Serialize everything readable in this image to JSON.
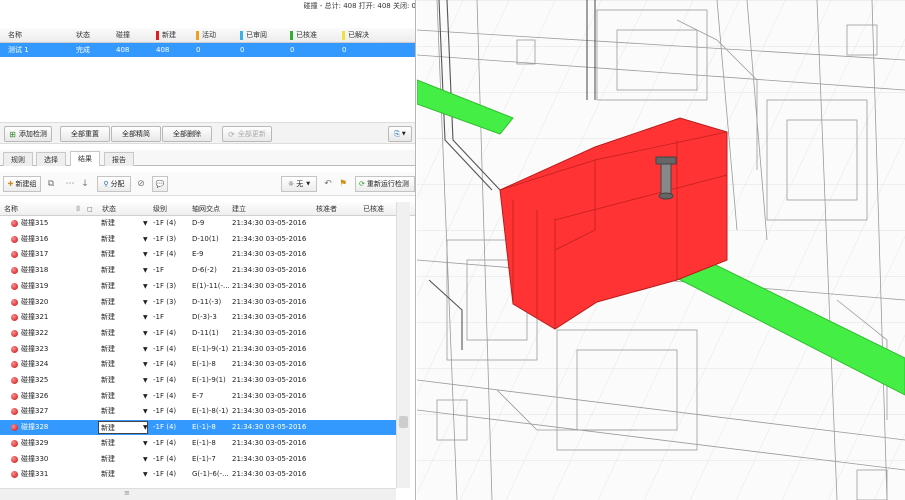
{
  "status_line": "碰撞 - 总计: 408 打开: 408 关闭: 0",
  "test_table": {
    "headers": {
      "name": "名称",
      "status": "状态",
      "clashes": "碰撞",
      "new": "新建",
      "active": "活动",
      "reviewed": "已审阅",
      "approved": "已核准",
      "resolved": "已解决"
    },
    "row": {
      "name": "测试 1",
      "status": "完成",
      "clashes": "408",
      "new": "408",
      "active": "0",
      "reviewed": "0",
      "approved": "0",
      "resolved": "0"
    }
  },
  "colors": {
    "new": "#e01e1e",
    "active": "#f0a020",
    "reviewed": "#3ab0e8",
    "approved": "#30b030",
    "resolved": "#f0e040",
    "selection": "#3399ff",
    "clash_box": "#ff3333",
    "pipe": "#44ee44"
  },
  "toolbar1": {
    "add_test": "添加检测",
    "reset_all": "全部重置",
    "compact_all": "全部精简",
    "delete_all": "全部删除",
    "update_all": "全部更新"
  },
  "tabs": [
    "规则",
    "选择",
    "结果",
    "报告"
  ],
  "toolbar2": {
    "new_group": "新建组",
    "assign": "分配",
    "none": "无",
    "rerun": "重新运行检测"
  },
  "results_headers": {
    "name": "名称",
    "status": "状态",
    "level": "级别",
    "grid": "轴网交点",
    "created": "建立",
    "approved_by": "核准者",
    "approved": "已核准"
  },
  "results": [
    {
      "name": "碰撞315",
      "status": "新建",
      "level": "-1F (4)",
      "grid": "D-9",
      "created": "21:34:30 03-05-2016"
    },
    {
      "name": "碰撞316",
      "status": "新建",
      "level": "-1F (3)",
      "grid": "D-10(1)",
      "created": "21:34:30 03-05-2016"
    },
    {
      "name": "碰撞317",
      "status": "新建",
      "level": "-1F (4)",
      "grid": "E-9",
      "created": "21:34:30 03-05-2016"
    },
    {
      "name": "碰撞318",
      "status": "新建",
      "level": "-1F",
      "grid": "D-6(-2)",
      "created": "21:34:30 03-05-2016"
    },
    {
      "name": "碰撞319",
      "status": "新建",
      "level": "-1F (3)",
      "grid": "E(1)-11(-...",
      "created": "21:34:30 03-05-2016"
    },
    {
      "name": "碰撞320",
      "status": "新建",
      "level": "-1F (3)",
      "grid": "D-11(-3)",
      "created": "21:34:30 03-05-2016"
    },
    {
      "name": "碰撞321",
      "status": "新建",
      "level": "-1F",
      "grid": "D(-3)-3",
      "created": "21:34:30 03-05-2016"
    },
    {
      "name": "碰撞322",
      "status": "新建",
      "level": "-1F (4)",
      "grid": "D-11(1)",
      "created": "21:34:30 03-05-2016"
    },
    {
      "name": "碰撞323",
      "status": "新建",
      "level": "-1F (4)",
      "grid": "E(-1)-9(-1)",
      "created": "21:34:30 03-05-2016"
    },
    {
      "name": "碰撞324",
      "status": "新建",
      "level": "-1F (4)",
      "grid": "E(-1)-8",
      "created": "21:34:30 03-05-2016"
    },
    {
      "name": "碰撞325",
      "status": "新建",
      "level": "-1F (4)",
      "grid": "E(-1)-9(1)",
      "created": "21:34:30 03-05-2016"
    },
    {
      "name": "碰撞326",
      "status": "新建",
      "level": "-1F (4)",
      "grid": "E-7",
      "created": "21:34:30 03-05-2016"
    },
    {
      "name": "碰撞327",
      "status": "新建",
      "level": "-1F (4)",
      "grid": "E(-1)-8(-1)",
      "created": "21:34:30 03-05-2016"
    },
    {
      "name": "碰撞328",
      "status": "新建",
      "level": "-1F (4)",
      "grid": "E(-1)-8",
      "created": "21:34:30 03-05-2016",
      "selected": true
    },
    {
      "name": "碰撞329",
      "status": "新建",
      "level": "-1F (4)",
      "grid": "E(-1)-8",
      "created": "21:34:30 03-05-2016"
    },
    {
      "name": "碰撞330",
      "status": "新建",
      "level": "-1F (4)",
      "grid": "E(-1)-7",
      "created": "21:34:30 03-05-2016"
    },
    {
      "name": "碰撞331",
      "status": "新建",
      "level": "-1F (4)",
      "grid": "G(-1)-6(-...",
      "created": "21:34:30 03-05-2016"
    }
  ]
}
